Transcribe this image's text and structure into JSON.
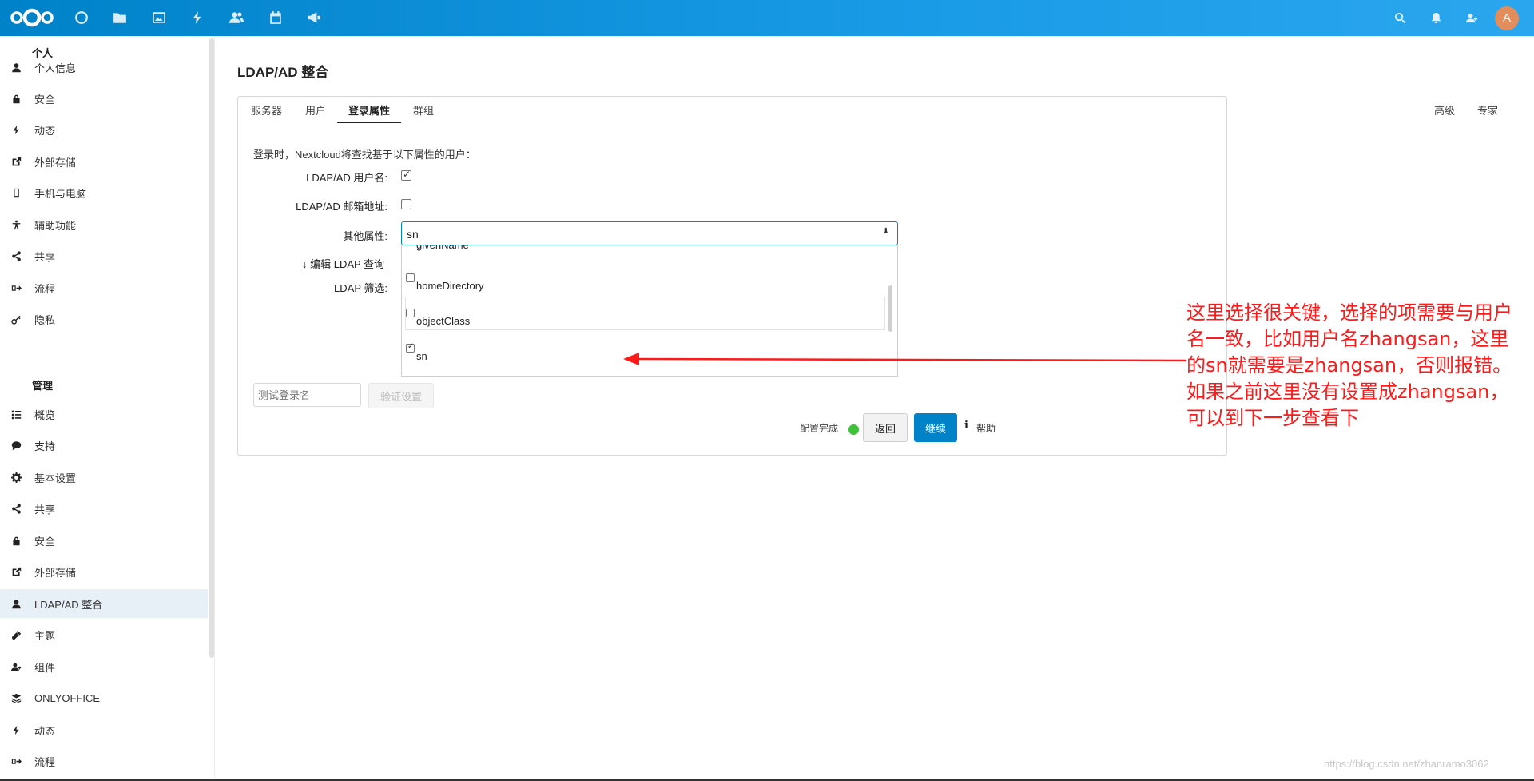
{
  "header": {
    "avatar_letter": "A",
    "app_icons": [
      "dashboard-icon",
      "files-icon",
      "photos-icon",
      "activity-icon",
      "contacts-icon",
      "calendar-icon",
      "announcements-icon"
    ],
    "right_icons": [
      "search-icon",
      "notifications-icon",
      "contacts-menu-icon"
    ],
    "color": "#0082c9"
  },
  "sidebar": {
    "personal_heading": "个人",
    "personal_items": [
      {
        "label": "个人信息",
        "icon": "user-icon"
      },
      {
        "label": "安全",
        "icon": "lock-icon"
      },
      {
        "label": "动态",
        "icon": "activity-icon"
      },
      {
        "label": "外部存储",
        "icon": "external-link-icon"
      },
      {
        "label": "手机与电脑",
        "icon": "phone-icon"
      },
      {
        "label": "辅助功能",
        "icon": "accessibility-icon"
      },
      {
        "label": "共享",
        "icon": "share-icon"
      },
      {
        "label": "流程",
        "icon": "flow-icon"
      },
      {
        "label": "隐私",
        "icon": "key-icon"
      }
    ],
    "admin_heading": "管理",
    "admin_items": [
      {
        "label": "概览",
        "icon": "overview-icon"
      },
      {
        "label": "支持",
        "icon": "support-icon"
      },
      {
        "label": "基本设置",
        "icon": "gear-icon"
      },
      {
        "label": "共享",
        "icon": "share-icon"
      },
      {
        "label": "安全",
        "icon": "lock-icon"
      },
      {
        "label": "外部存储",
        "icon": "external-link-icon"
      },
      {
        "label": "LDAP/AD 整合",
        "icon": "user-icon"
      },
      {
        "label": "主题",
        "icon": "theming-icon"
      },
      {
        "label": "组件",
        "icon": "apps-icon"
      },
      {
        "label": "ONLYOFFICE",
        "icon": "onlyoffice-icon"
      },
      {
        "label": "动态",
        "icon": "activity-icon"
      },
      {
        "label": "流程",
        "icon": "flow-icon"
      }
    ]
  },
  "main": {
    "title": "LDAP/AD 整合",
    "tabs": [
      "服务器",
      "用户",
      "登录属性",
      "群组"
    ],
    "tabs_right": [
      "高级",
      "专家"
    ],
    "description": "登录时，Nextcloud将查找基于以下属性的用户：",
    "username_label": "LDAP/AD 用户名:",
    "email_label": "LDAP/AD 邮箱地址:",
    "other_label": "其他属性:",
    "other_value": "sn",
    "dropdown_items": [
      {
        "label": "givenName",
        "checked": false
      },
      {
        "label": "homeDirectory",
        "checked": false
      },
      {
        "label": "objectClass",
        "checked": false
      },
      {
        "label": "sn",
        "checked": true
      }
    ],
    "edit_query_link": "↓ 编辑 LDAP 查询",
    "filter_label": "LDAP 筛选:",
    "test_login_placeholder": "测试登录名",
    "verify_button": "验证设置",
    "status_text": "配置完成",
    "back_button": "返回",
    "continue_button": "继续",
    "help_icon": "i",
    "help_text": "帮助"
  },
  "annotation": {
    "text": "这里选择很关键，选择的项需要与用户名一致，比如用户名zhangsan，这里的sn就需要是zhangsan，否则报错。如果之前这里没有设置成zhangsan，可以到下一步查看下",
    "color": "#ff1a1a"
  },
  "watermark": "https://blog.csdn.net/zhanramo3062"
}
